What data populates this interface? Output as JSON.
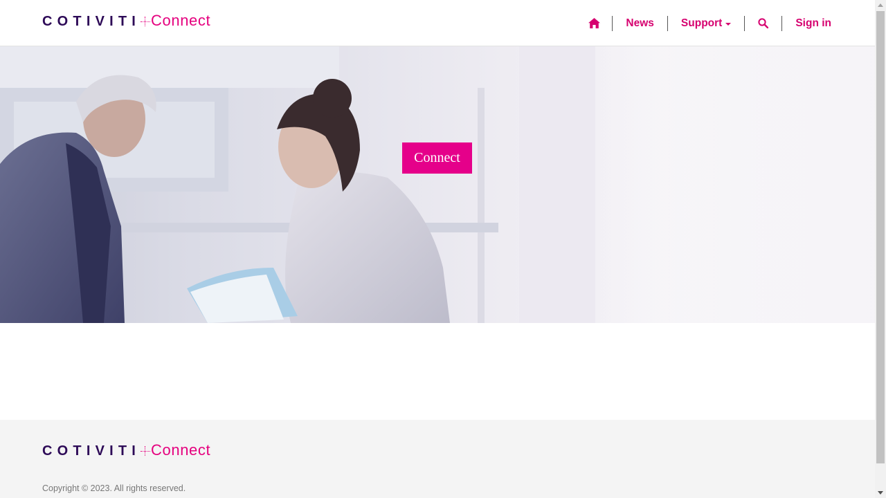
{
  "header": {
    "logo": {
      "brand": "COTIVITI",
      "product": "Connect"
    },
    "nav": {
      "home_icon": "home-icon",
      "news_label": "News",
      "support_label": "Support",
      "search_icon": "search-icon",
      "signin_label": "Sign in"
    }
  },
  "hero": {
    "button_label": "Connect"
  },
  "footer": {
    "logo": {
      "brand": "COTIVITI",
      "product": "Connect"
    },
    "copyright": "Copyright © 2023. All rights reserved."
  },
  "colors": {
    "accent": "#e5008a",
    "nav_text": "#d6006f",
    "brand_dark": "#2d0a57"
  }
}
